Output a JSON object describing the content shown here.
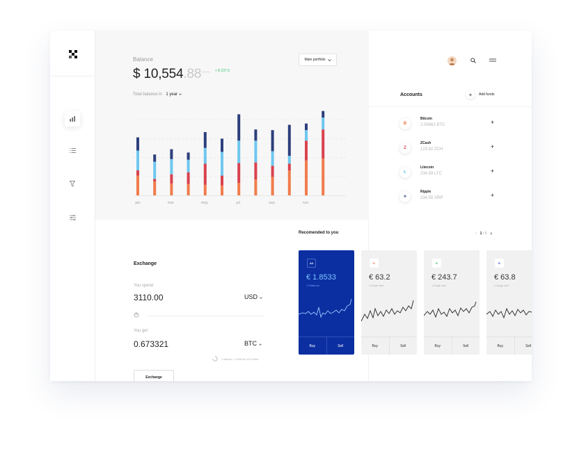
{
  "balance": {
    "label": "Balance",
    "currency_symbol": "$",
    "whole": "10,554",
    "cents": ".88",
    "delta": "+ $ 237.5",
    "portfolio_label": "Main portfolio",
    "total_label": "Total balance in",
    "period": "1 year"
  },
  "chart_data": {
    "type": "bar",
    "stacked": true,
    "x_tick_labels": [
      "jan",
      "mar",
      "may",
      "jul",
      "sep",
      "nov"
    ],
    "categories": [
      "1",
      "2",
      "3",
      "4",
      "5",
      "6",
      "7",
      "8",
      "9",
      "10",
      "11",
      "12"
    ],
    "series": [
      {
        "color": "#f07c4c",
        "values": [
          30,
          21,
          18,
          17,
          16,
          15,
          19,
          24,
          28,
          38,
          53,
          56
        ]
      },
      {
        "color": "#d9424e",
        "values": [
          8,
          4,
          14,
          18,
          32,
          15,
          30,
          26,
          17,
          10,
          30,
          44
        ]
      },
      {
        "color": "#6ec7ef",
        "values": [
          30,
          26,
          23,
          19,
          24,
          36,
          34,
          33,
          22,
          12,
          16,
          18
        ]
      },
      {
        "color": "#2d3f7c",
        "values": [
          20,
          11,
          15,
          11,
          24,
          20,
          40,
          17,
          32,
          47,
          10,
          10
        ]
      }
    ],
    "colors": {
      "orange": "#f07c4c",
      "red": "#d9424e",
      "lightblue": "#6ec7ef",
      "navy": "#2d3f7c"
    },
    "ylim": [
      0,
      135
    ],
    "grid": "dotted"
  },
  "exchange": {
    "title": "Exchange",
    "spend_label": "You spend",
    "spend_value": "3110.00",
    "spend_currency": "USD",
    "get_label": "You get",
    "get_value": "0.673321",
    "get_currency": "BTC",
    "rate_note": "1 Bitcoin = 4,565.66 US Dollar",
    "button_label": "Exchange"
  },
  "accounts": {
    "title": "Accounts",
    "add_funds_label": "Add funds",
    "items": [
      {
        "name": "Bitcoin",
        "amount": "2.05462 BTC",
        "glyph": "Ƀ",
        "color": "#f07c4c"
      },
      {
        "name": "ZCash",
        "amount": "123.92 ZCH",
        "glyph": "Z",
        "color": "#d9424e"
      },
      {
        "name": "Litecoin",
        "amount": "234.59 LTC",
        "glyph": "Ł",
        "color": "#6ec7ef"
      },
      {
        "name": "Ripple",
        "amount": "234.55 XRP",
        "glyph": "⟡",
        "color": "#2d3f7c"
      }
    ]
  },
  "recommended": {
    "title": "Recomended to you",
    "pager_current": "1",
    "pager_total": "5",
    "cards": [
      {
        "badge": "A4",
        "price": "€ 1.8533",
        "sub": "1 Platinum",
        "buy": "Buy",
        "sell": "Sell",
        "style": "blue",
        "badge_color": "#ffffff"
      },
      {
        "badge": "Ð",
        "price": "€ 63.2",
        "sub": "1 Doge coin",
        "buy": "Buy",
        "sell": "Sell",
        "style": "grey",
        "badge_color": "#f07c4c"
      },
      {
        "badge": "Ð",
        "price": "€ 243.7",
        "sub": "1 Doge coin",
        "buy": "Buy",
        "sell": "Sell",
        "style": "grey",
        "badge_color": "#3cc173"
      },
      {
        "badge": "Ð",
        "price": "€ 63.8",
        "sub": "1 Doge coin",
        "buy": "Buy",
        "sell": "Sell",
        "style": "grey",
        "badge_color": "#4a5bd4"
      }
    ]
  }
}
